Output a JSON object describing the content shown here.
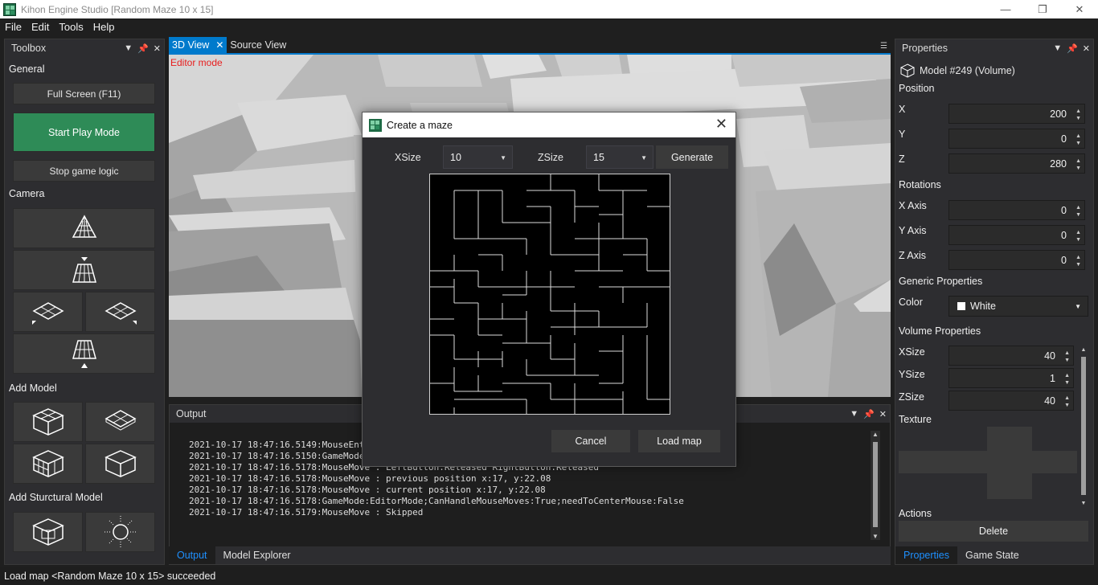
{
  "window": {
    "title": "Kihon Engine Studio [Random Maze 10 x 15]"
  },
  "menu": [
    "File",
    "Edit",
    "Tools",
    "Help"
  ],
  "toolbox": {
    "title": "Toolbox",
    "general_label": "General",
    "fullscreen_label": "Full Screen (F11)",
    "start_play_label": "Start Play Mode",
    "stop_logic_label": "Stop game logic",
    "camera_label": "Camera",
    "add_model_label": "Add Model",
    "add_structural_label": "Add Sturctural Model"
  },
  "view": {
    "tab_3d": "3D View",
    "tab_source": "Source View",
    "editor_mode": "Editor mode"
  },
  "output": {
    "title": "Output",
    "lines": [
      "2021-10-17 18:47:16.5149:MouseEnt",
      "2021-10-17 18:47:16.5150:GameMode",
      "2021-10-17 18:47:16.5178:MouseMove : LeftButton:Released RightButton:Released",
      "2021-10-17 18:47:16.5178:MouseMove : previous position x:17, y:22.08",
      "2021-10-17 18:47:16.5178:MouseMove : current position x:17, y:22.08",
      "2021-10-17 18:47:16.5178:GameMode:EditorMode;CanHandleMouseMoves:True;needToCenterMouse:False",
      "2021-10-17 18:47:16.5179:MouseMove : Skipped"
    ],
    "tab_output": "Output",
    "tab_model_explorer": "Model Explorer"
  },
  "properties": {
    "title": "Properties",
    "model_name": "Model #249 (Volume)",
    "position_label": "Position",
    "x_label": "X",
    "x_value": "200",
    "y_label": "Y",
    "y_value": "0",
    "z_label": "Z",
    "z_value": "280",
    "rotations_label": "Rotations",
    "xaxis_label": "X Axis",
    "xaxis_value": "0",
    "yaxis_label": "Y Axis",
    "yaxis_value": "0",
    "zaxis_label": "Z Axis",
    "zaxis_value": "0",
    "generic_label": "Generic Properties",
    "color_label": "Color",
    "color_value": "White",
    "volume_label": "Volume Properties",
    "xsize_label": "XSize",
    "xsize_value": "40",
    "ysize_label": "YSize",
    "ysize_value": "1",
    "zsize_label": "ZSize",
    "zsize_value": "40",
    "texture_label": "Texture",
    "actions_label": "Actions",
    "delete_label": "Delete",
    "tab_properties": "Properties",
    "tab_game_state": "Game State"
  },
  "dialog": {
    "title": "Create a maze",
    "xsize_label": "XSize",
    "xsize_value": "10",
    "zsize_label": "ZSize",
    "zsize_value": "15",
    "generate_label": "Generate",
    "cancel_label": "Cancel",
    "load_label": "Load map"
  },
  "status": {
    "text": "Load map <Random Maze 10 x 15> succeeded"
  }
}
